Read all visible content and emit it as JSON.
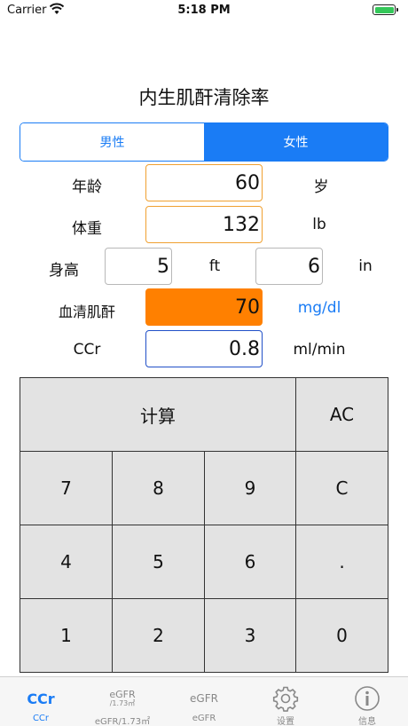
{
  "status_bar": {
    "carrier": "Carrier",
    "time": "5:18 PM"
  },
  "title": "内生肌酐清除率",
  "gender": {
    "male": "男性",
    "female": "女性",
    "selected": "female"
  },
  "fields": {
    "age": {
      "label": "年龄",
      "value": "60",
      "unit": "岁"
    },
    "weight": {
      "label": "体重",
      "value": "132",
      "unit": "lb"
    },
    "height": {
      "label": "身高",
      "feet": "5",
      "feet_unit": "ft",
      "inches": "6",
      "inch_unit": "in"
    },
    "creatinine": {
      "label": "血清肌酐",
      "value": "70",
      "unit": "mg/dl"
    },
    "ccr": {
      "label": "CCr",
      "value": "0.8",
      "unit": "ml/min"
    }
  },
  "keypad": {
    "calculate": "计算",
    "clear_all": "AC",
    "k7": "7",
    "k8": "8",
    "k9": "9",
    "clear": "C",
    "k4": "4",
    "k5": "5",
    "k6": "6",
    "dot": ".",
    "k1": "1",
    "k2": "2",
    "k3": "3",
    "k0": "0"
  },
  "tabs": {
    "ccr": {
      "icon_text": "CCr",
      "label": "CCr"
    },
    "egfr173": {
      "icon_line1": "eGFR",
      "icon_line2": "/1.73㎡",
      "label": "eGFR/1.73㎡"
    },
    "egfr": {
      "icon_text": "eGFR",
      "label": "eGFR"
    },
    "settings": {
      "label": "设置",
      "icon": "gear-icon"
    },
    "info": {
      "label": "信息",
      "icon": "info-icon"
    }
  },
  "colors": {
    "accent": "#1a7cf5",
    "input_highlight": "#ff8000",
    "input_border": "#f0a030"
  }
}
